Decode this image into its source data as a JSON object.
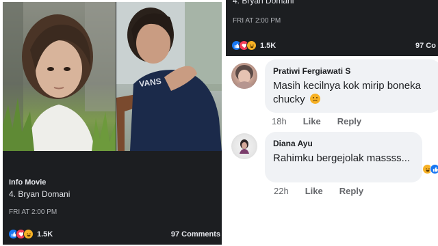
{
  "left_post": {
    "title": "Info Movie",
    "subtitle": "4. Bryan Domani",
    "time": "FRI AT 2:00 PM",
    "reaction_count": "1.5K",
    "comments_label": "97 Comments"
  },
  "right_post": {
    "subtitle": "4. Bryan Domani",
    "time": "FRI AT 2:00 PM",
    "reaction_count": "1.5K",
    "comments_label": "97 Co"
  },
  "comments": [
    {
      "author": "Pratiwi Fergiawati S",
      "text": "Masih kecilnya kok mirip boneka chucky",
      "emoji": "sad",
      "time": "18h",
      "like": "Like",
      "reply": "Reply"
    },
    {
      "author": "Diana Ayu",
      "text": "Rahimku bergejolak massss...",
      "time": "22h",
      "like": "Like",
      "reply": "Reply"
    }
  ],
  "reaction_icons": [
    "like",
    "love",
    "haha"
  ],
  "colors": {
    "dark_bg": "#1c1e21",
    "bubble_bg": "#f0f2f5",
    "like_blue": "#1877f2",
    "love_red": "#f33e58",
    "haha_yellow": "#f7b125"
  }
}
